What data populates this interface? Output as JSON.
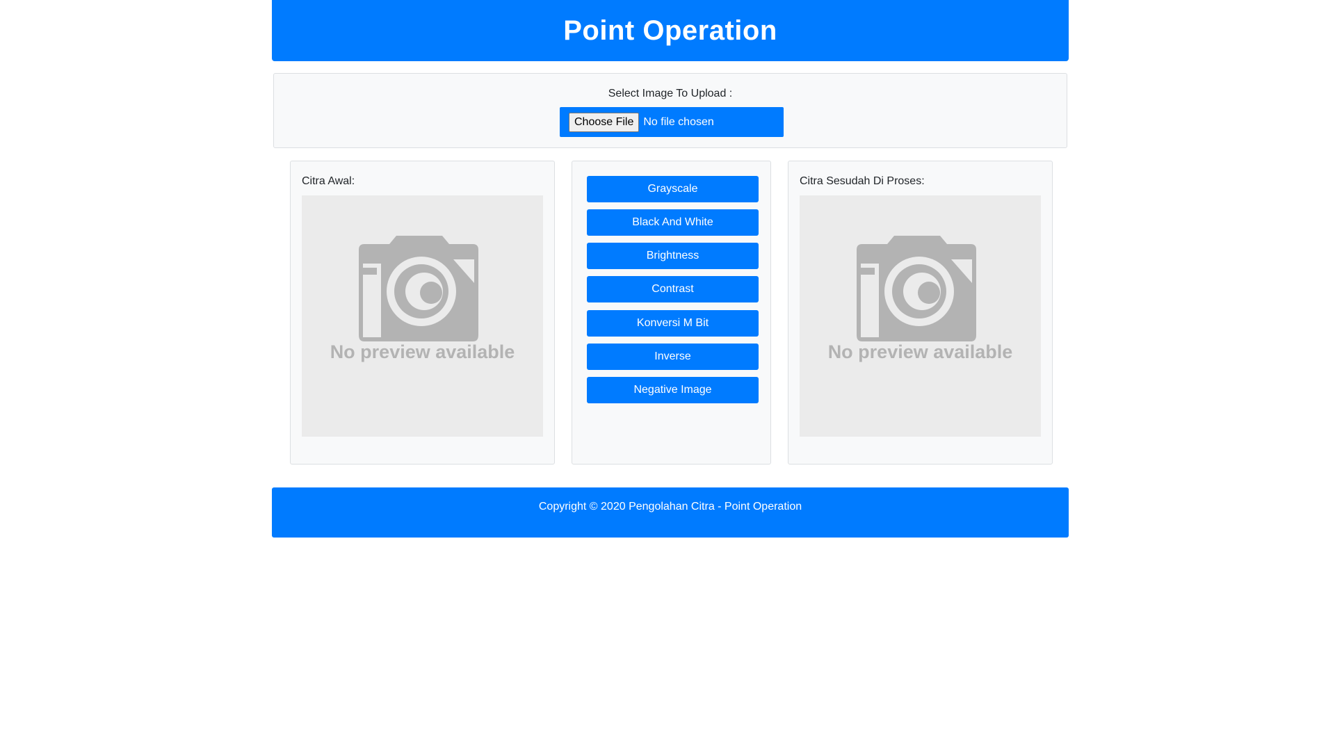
{
  "header": {
    "title": "Point Operation"
  },
  "upload": {
    "label": "Select Image To Upload :",
    "choose_file_label": "Choose File",
    "file_status": "No file chosen"
  },
  "original_panel": {
    "title": "Citra Awal:",
    "preview_text": "No preview available",
    "preview_icon": "camera-icon"
  },
  "operations": {
    "buttons": [
      "Grayscale",
      "Black And White",
      "Brightness",
      "Contrast",
      "Konversi M Bit",
      "Inverse",
      "Negative Image"
    ]
  },
  "result_panel": {
    "title": "Citra Sesudah Di Proses:",
    "preview_text": "No preview available",
    "preview_icon": "camera-icon"
  },
  "footer": {
    "copyright": "Copyright © 2020 Pengolahan Citra - Point Operation"
  },
  "colors": {
    "primary": "#007bff",
    "panel_background": "#f8f9fa",
    "preview_background": "#ebebeb",
    "placeholder_gray": "#b3b3b3"
  }
}
